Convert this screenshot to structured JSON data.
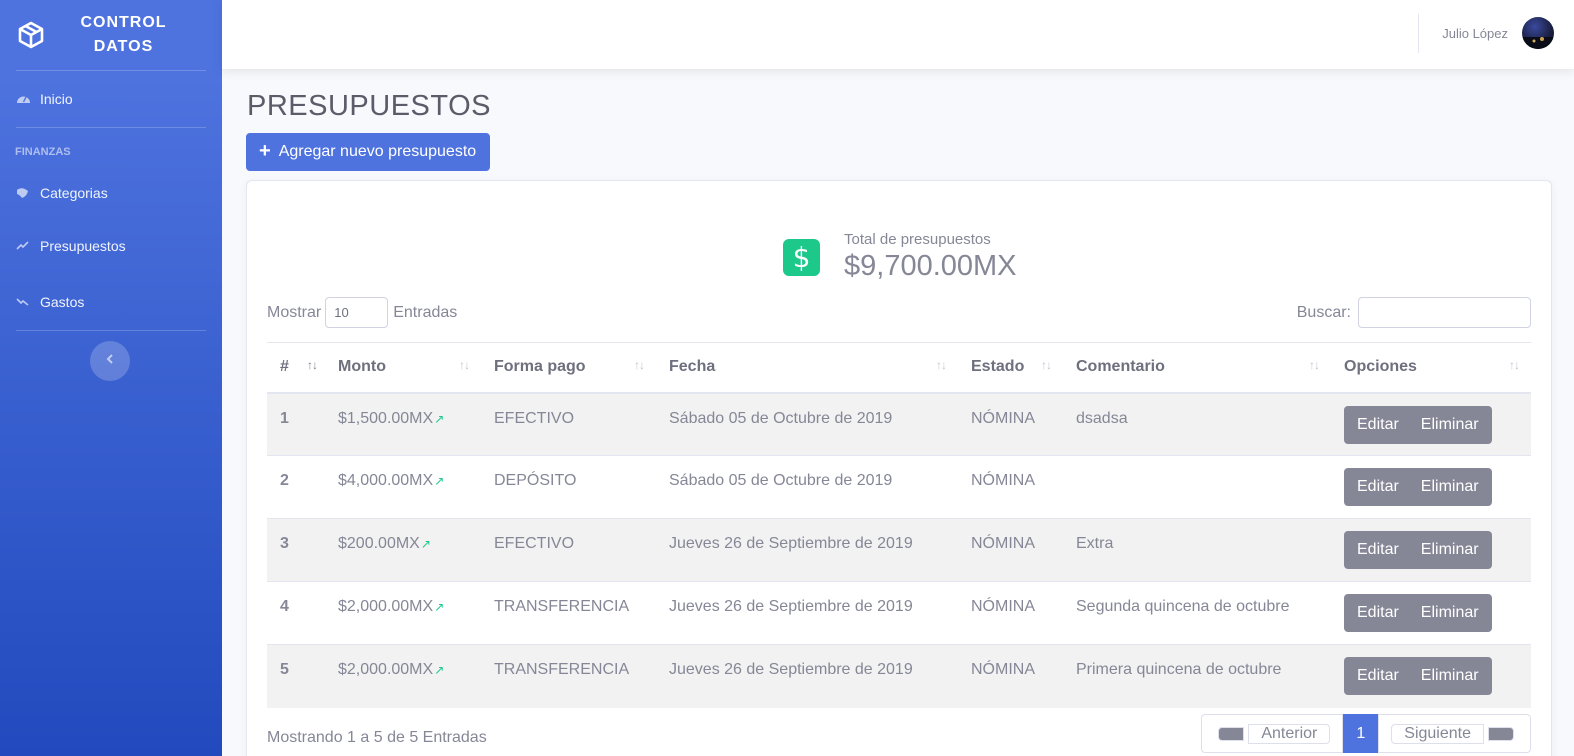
{
  "brand": {
    "line1": "CONTROL",
    "line2": "DATOS"
  },
  "sidebar": {
    "home": {
      "label": "Inicio"
    },
    "heading": "FINANZAS",
    "items": [
      {
        "label": "Categorias",
        "icon": "palette-icon"
      },
      {
        "label": "Presupuestos",
        "icon": "chart-line-icon"
      },
      {
        "label": "Gastos",
        "icon": "chart-down-icon"
      }
    ]
  },
  "topbar": {
    "user_name": "Julio López"
  },
  "page": {
    "title": "PRESUPUESTOS",
    "add_button": "Agregar nuevo presupuesto"
  },
  "summary": {
    "label": "Total de presupuestos",
    "value": "$9,700.00MX"
  },
  "table_controls": {
    "show_label": "Mostrar",
    "show_value": "10",
    "entries_label": "Entradas",
    "search_label": "Buscar:",
    "search_value": ""
  },
  "table": {
    "headers": [
      "#",
      "Monto",
      "Forma pago",
      "Fecha",
      "Estado",
      "Comentario",
      "Opciones"
    ],
    "rows": [
      {
        "id": "1",
        "amount": "$1,500.00MX",
        "method": "EFECTIVO",
        "date": "Sábado 05 de Octubre de 2019",
        "status": "NÓMINA",
        "comment": "dsadsa"
      },
      {
        "id": "2",
        "amount": "$4,000.00MX",
        "method": "DEPÓSITO",
        "date": "Sábado 05 de Octubre de 2019",
        "status": "NÓMINA",
        "comment": ""
      },
      {
        "id": "3",
        "amount": "$200.00MX",
        "method": "EFECTIVO",
        "date": "Jueves 26 de Septiembre de 2019",
        "status": "NÓMINA",
        "comment": "Extra"
      },
      {
        "id": "4",
        "amount": "$2,000.00MX",
        "method": "TRANSFERENCIA",
        "date": "Jueves 26 de Septiembre de 2019",
        "status": "NÓMINA",
        "comment": "Segunda quincena de octubre"
      },
      {
        "id": "5",
        "amount": "$2,000.00MX",
        "method": "TRANSFERENCIA",
        "date": "Jueves 26 de Septiembre de 2019",
        "status": "NÓMINA",
        "comment": "Primera quincena de octubre"
      }
    ],
    "edit_label": "Editar",
    "delete_label": "Eliminar"
  },
  "footer": {
    "info": "Mostrando 1 a 5 de 5 Entradas",
    "prev": "Anterior",
    "page": "1",
    "next": "Siguiente"
  },
  "colors": {
    "primary": "#4e73df",
    "success": "#1cc88a",
    "secondary": "#858796"
  }
}
